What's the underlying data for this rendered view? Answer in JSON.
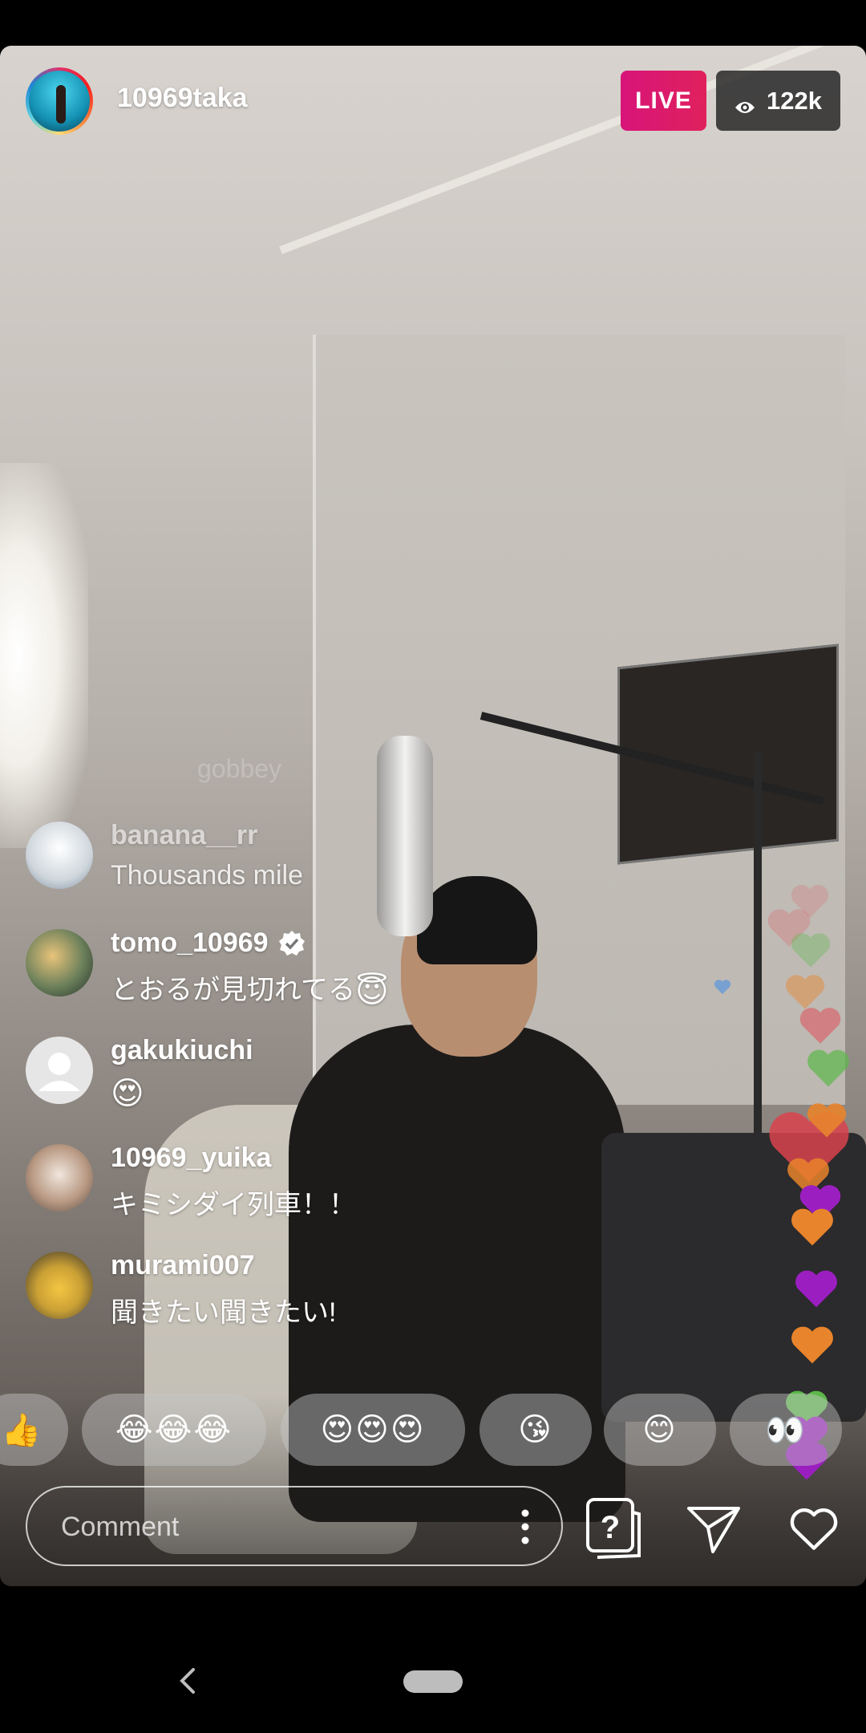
{
  "host": {
    "username": "10969taka"
  },
  "badges": {
    "live": "LIVE",
    "viewers": "122k"
  },
  "comments": {
    "faded_partial": "gobbey",
    "items": [
      {
        "user": "banana__rr",
        "text": "Thousands mile",
        "verified": false
      },
      {
        "user": "tomo_10969",
        "text": "とおるが見切れてる",
        "emoji": "😇",
        "verified": true
      },
      {
        "user": "gakukiuchi",
        "text": "",
        "emoji": "😍",
        "verified": false
      },
      {
        "user": "10969_yuika",
        "text": "キミシダイ列車！！",
        "verified": false
      },
      {
        "user": "murami007",
        "text": "聞きたい聞きたい!",
        "verified": false
      }
    ]
  },
  "reactions": [
    "👍",
    "😂😂😂",
    "😍😍😍",
    "😘",
    "😊",
    "👀"
  ],
  "comment_bar": {
    "placeholder": "Comment"
  },
  "colors": {
    "live": "#d8147a",
    "heart_pink": "#e0505a",
    "heart_green": "#5cb84a",
    "heart_orange": "#e8842c",
    "heart_purple": "#9b1fc0"
  },
  "icons": [
    "eye-icon",
    "verified-icon",
    "more-vert-icon",
    "question-sticker-icon",
    "send-icon",
    "heart-icon",
    "back-icon"
  ]
}
